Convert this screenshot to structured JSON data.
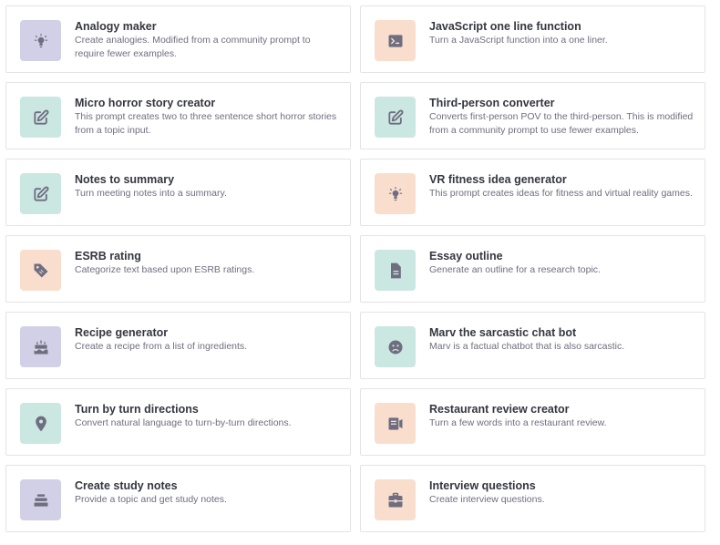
{
  "colors": {
    "purple": "#d2d0e6",
    "orange": "#f9dece",
    "teal": "#cbe7e2",
    "icon": "#6e6e80"
  },
  "cards": [
    {
      "title": "Analogy maker",
      "description": "Create analogies. Modified from a community prompt to require fewer examples.",
      "icon": "lightbulb-icon",
      "color": "purple"
    },
    {
      "title": "JavaScript one line function",
      "description": "Turn a JavaScript function into a one liner.",
      "icon": "terminal-icon",
      "color": "orange"
    },
    {
      "title": "Micro horror story creator",
      "description": "This prompt creates two to three sentence short horror stories from a topic input.",
      "icon": "edit-icon",
      "color": "teal"
    },
    {
      "title": "Third-person converter",
      "description": "Converts first-person POV to the third-person. This is modified from a community prompt to use fewer examples.",
      "icon": "edit-icon",
      "color": "teal"
    },
    {
      "title": "Notes to summary",
      "description": "Turn meeting notes into a summary.",
      "icon": "edit-icon",
      "color": "teal"
    },
    {
      "title": "VR fitness idea generator",
      "description": "This prompt creates ideas for fitness and virtual reality games.",
      "icon": "lightbulb-icon",
      "color": "orange"
    },
    {
      "title": "ESRB rating",
      "description": "Categorize text based upon ESRB ratings.",
      "icon": "tag-icon",
      "color": "orange"
    },
    {
      "title": "Essay outline",
      "description": "Generate an outline for a research topic.",
      "icon": "document-icon",
      "color": "teal"
    },
    {
      "title": "Recipe generator",
      "description": "Create a recipe from a list of ingredients.",
      "icon": "cake-icon",
      "color": "purple"
    },
    {
      "title": "Marv the sarcastic chat bot",
      "description": "Marv is a factual chatbot that is also sarcastic.",
      "icon": "sad-face-icon",
      "color": "teal"
    },
    {
      "title": "Turn by turn directions",
      "description": "Convert natural language to turn-by-turn directions.",
      "icon": "map-pin-icon",
      "color": "teal"
    },
    {
      "title": "Restaurant review creator",
      "description": "Turn a few words into a restaurant review.",
      "icon": "review-icon",
      "color": "orange"
    },
    {
      "title": "Create study notes",
      "description": "Provide a topic and get study notes.",
      "icon": "stack-icon",
      "color": "purple"
    },
    {
      "title": "Interview questions",
      "description": "Create interview questions.",
      "icon": "briefcase-icon",
      "color": "orange"
    }
  ]
}
